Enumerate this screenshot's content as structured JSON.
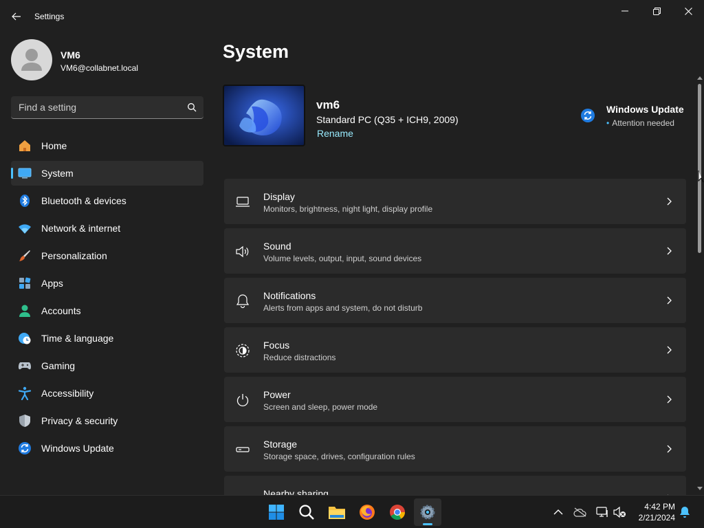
{
  "window": {
    "title": "Settings",
    "controls": [
      "minimize",
      "maximize",
      "close"
    ]
  },
  "profile": {
    "name": "VM6",
    "email": "VM6@collabnet.local"
  },
  "search": {
    "placeholder": "Find a setting",
    "value": ""
  },
  "sidebar": {
    "items": [
      {
        "label": "Home",
        "icon": "home-icon"
      },
      {
        "label": "System",
        "icon": "system-icon",
        "active": true
      },
      {
        "label": "Bluetooth & devices",
        "icon": "bluetooth-icon"
      },
      {
        "label": "Network & internet",
        "icon": "wifi-icon"
      },
      {
        "label": "Personalization",
        "icon": "brush-icon"
      },
      {
        "label": "Apps",
        "icon": "apps-icon"
      },
      {
        "label": "Accounts",
        "icon": "accounts-icon"
      },
      {
        "label": "Time & language",
        "icon": "clock-globe-icon"
      },
      {
        "label": "Gaming",
        "icon": "gamepad-icon"
      },
      {
        "label": "Accessibility",
        "icon": "accessibility-icon"
      },
      {
        "label": "Privacy & security",
        "icon": "shield-icon"
      },
      {
        "label": "Windows Update",
        "icon": "update-icon"
      }
    ]
  },
  "main": {
    "title": "System",
    "device": {
      "name": "vm6",
      "model": "Standard PC (Q35 + ICH9, 2009)",
      "rename_label": "Rename"
    },
    "windows_update": {
      "title": "Windows Update",
      "status": "Attention needed"
    },
    "cards": [
      {
        "title": "Display",
        "desc": "Monitors, brightness, night light, display profile",
        "icon": "display-icon"
      },
      {
        "title": "Sound",
        "desc": "Volume levels, output, input, sound devices",
        "icon": "speaker-icon"
      },
      {
        "title": "Notifications",
        "desc": "Alerts from apps and system, do not disturb",
        "icon": "bell-icon"
      },
      {
        "title": "Focus",
        "desc": "Reduce distractions",
        "icon": "focus-icon"
      },
      {
        "title": "Power",
        "desc": "Screen and sleep, power mode",
        "icon": "power-icon"
      },
      {
        "title": "Storage",
        "desc": "Storage space, drives, configuration rules",
        "icon": "storage-icon"
      },
      {
        "title": "Nearby sharing",
        "desc": "",
        "icon": "share-icon"
      }
    ]
  },
  "taskbar": {
    "apps": [
      "start-icon",
      "search-icon",
      "file-explorer-icon",
      "firefox-icon",
      "chrome-icon",
      "settings-icon"
    ],
    "tray": [
      "chevron-up-icon",
      "onedrive-icon",
      "network-icon",
      "volume-muted-icon",
      "notification-bell-icon"
    ],
    "time": "4:42 PM",
    "date": "2/21/2024"
  },
  "colors": {
    "background": "#202020",
    "card": "#2b2b2b",
    "accent": "#4cc2ff",
    "link": "#99ebff"
  }
}
